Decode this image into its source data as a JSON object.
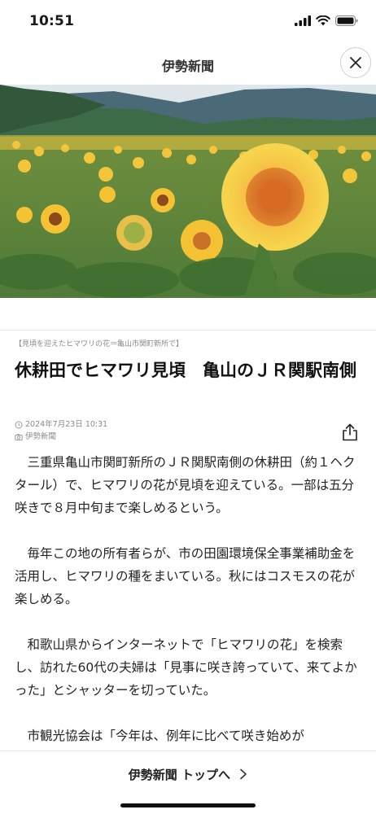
{
  "status_bar": {
    "time": "10:51",
    "icons": [
      "signal-icon",
      "wifi-icon",
      "battery-icon"
    ]
  },
  "header": {
    "title": "伊勢新聞",
    "close_icon": "close-icon"
  },
  "hero_image": {
    "alt": "sunflower-field-photo"
  },
  "article": {
    "photo_caption": "【見頃を迎えたヒマワリの花＝亀山市関町新所で】",
    "headline": "休耕田でヒマワリ見頃　亀山のＪＲ関駅南側",
    "date": "2024年7月23日 10:31",
    "source": "伊勢新聞",
    "paragraphs": [
      "三重県亀山市関町新所のＪＲ関駅南側の休耕田（約１ヘクタール）で、ヒマワリの花が見頃を迎えている。一部は五分咲きで８月中旬まで楽しめるという。",
      "毎年この地の所有者らが、市の田園環境保全事業補助金を活用し、ヒマワリの種をまいている。秋にはコスモスの花が楽しめる。",
      "和歌山県からインターネットで「ヒマワリの花」を検索し、訪れた60代の夫婦は「見事に咲き誇っていて、来てよかった」とシャッターを切っていた。",
      "市観光協会は「今年は、例年に比べて咲き始めが"
    ]
  },
  "footer": {
    "top_link": "伊勢新聞 トップへ"
  },
  "colors": {
    "accent": "#1a1a1a",
    "meta_text": "#8a8a8a",
    "sunflower": "#f4c430"
  }
}
